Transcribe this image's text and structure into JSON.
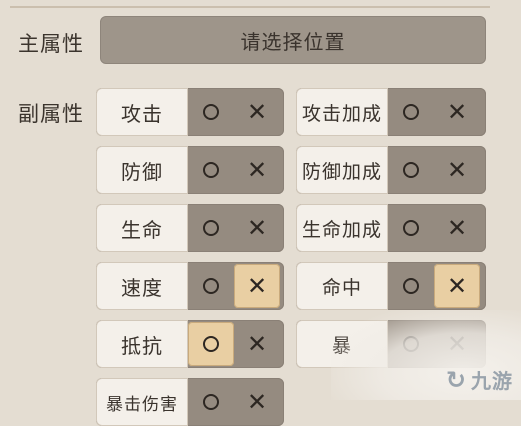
{
  "main_attr": {
    "label": "主属性",
    "placeholder": "请选择位置"
  },
  "sub_attr": {
    "label": "副属性"
  },
  "stats_left": [
    {
      "name": "攻击",
      "circle_active": false,
      "cross_active": false
    },
    {
      "name": "防御",
      "circle_active": false,
      "cross_active": false
    },
    {
      "name": "生命",
      "circle_active": false,
      "cross_active": false
    },
    {
      "name": "速度",
      "circle_active": false,
      "cross_active": true
    },
    {
      "name": "抵抗",
      "circle_active": true,
      "cross_active": false
    },
    {
      "name": "暴击伤害",
      "circle_active": false,
      "cross_active": false
    }
  ],
  "stats_right": [
    {
      "name": "攻击加成",
      "circle_active": false,
      "cross_active": false
    },
    {
      "name": "防御加成",
      "circle_active": false,
      "cross_active": false
    },
    {
      "name": "生命加成",
      "circle_active": false,
      "cross_active": false
    },
    {
      "name": "命中",
      "circle_active": false,
      "cross_active": true
    },
    {
      "name": "暴",
      "circle_active": false,
      "cross_active": false
    }
  ],
  "icons": {
    "circle": "circle-icon",
    "cross": "cross-icon"
  },
  "watermark": {
    "text": "九游"
  }
}
